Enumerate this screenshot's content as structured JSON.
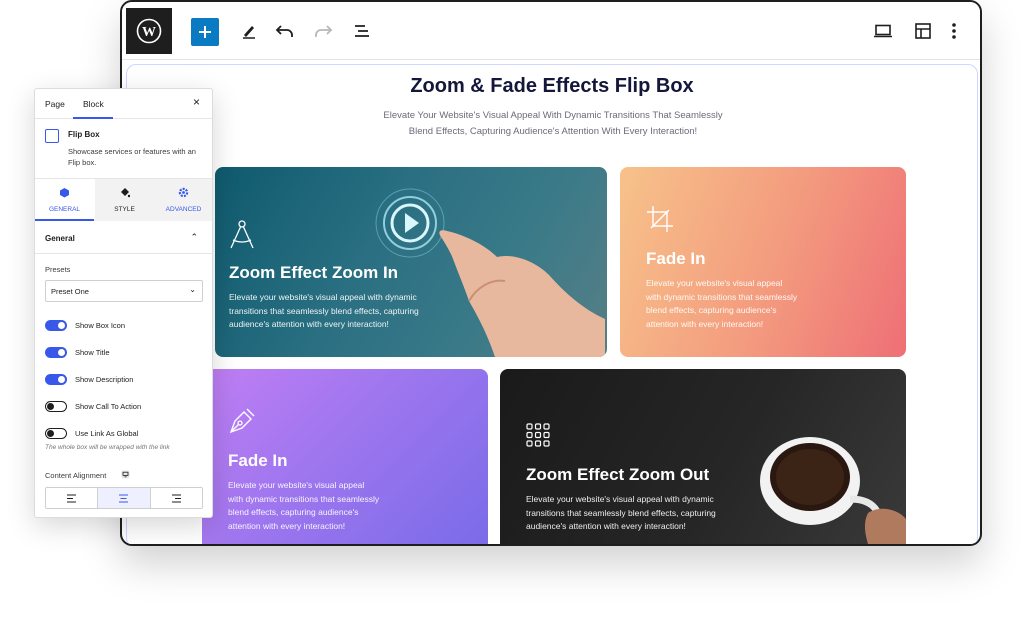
{
  "toolbar": {
    "wp_logo": "wordpress-icon",
    "add_icon": "plus-icon",
    "tools_icon": "pencil-icon",
    "undo_icon": "undo-icon",
    "redo_icon": "redo-icon",
    "outline_icon": "list-view-icon",
    "device_icon": "laptop-icon",
    "template_icon": "layout-icon",
    "options_icon": "more-vertical-icon"
  },
  "page": {
    "title": "Zoom & Fade Effects Flip Box",
    "subtitle_line1": "Elevate Your Website's Visual Appeal With Dynamic Transitions That Seamlessly",
    "subtitle_line2": "Blend Effects, Capturing Audience's Attention With Every Interaction!"
  },
  "cards": [
    {
      "title": "Zoom Effect Zoom In",
      "desc_lines": [
        "Elevate your website's visual appeal with dynamic",
        "transitions that seamlessly blend effects, capturing",
        "audience's attention with every interaction!"
      ],
      "icon": "compass-icon"
    },
    {
      "title": "Fade In",
      "desc_lines": [
        "Elevate your website's visual appeal",
        "with dynamic transitions that seamlessly",
        "blend effects, capturing audience's",
        "attention with every interaction!"
      ],
      "icon": "crop-icon"
    },
    {
      "title": "Fade In",
      "desc_lines": [
        "Elevate your website's visual appeal",
        "with dynamic transitions that seamlessly",
        "blend effects, capturing audience's",
        "attention with every interaction!"
      ],
      "icon": "pen-tool-icon"
    },
    {
      "title": "Zoom Effect Zoom Out",
      "desc_lines": [
        "Elevate your website's visual appeal with dynamic",
        "transitions that seamlessly blend effects, capturing",
        "audience's attention with every interaction!"
      ],
      "icon": "grid-dots-icon"
    }
  ],
  "panel": {
    "tabs": [
      "Page",
      "Block"
    ],
    "active_tab": "Block",
    "close": "×",
    "block_name": "Flip Box",
    "block_desc": "Showcase services or features with an Flip box.",
    "subtabs": [
      "GENERAL",
      "STYLE",
      "ADVANCED"
    ],
    "section_title": "General",
    "presets_label": "Presets",
    "preset_value": "Preset One",
    "toggles": [
      {
        "label": "Show Box Icon",
        "on": true
      },
      {
        "label": "Show Title",
        "on": true
      },
      {
        "label": "Show Description",
        "on": true
      },
      {
        "label": "Show Call To Action",
        "on": false
      },
      {
        "label": "Use Link As Global",
        "on": false
      }
    ],
    "link_help": "The whole box will be wrapped with the link",
    "alignment_label": "Content Alignment",
    "alignment_options": [
      "left",
      "center",
      "right"
    ],
    "alignment_selected": "center"
  },
  "colors": {
    "accent": "#3858e9",
    "wp_blue": "#0a7bc2"
  }
}
